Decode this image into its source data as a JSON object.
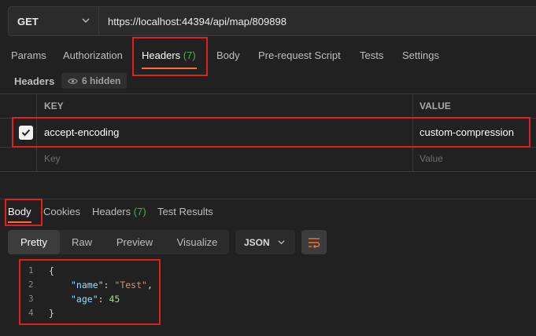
{
  "request": {
    "method": "GET",
    "url": "https://localhost:44394/api/map/809898"
  },
  "request_tabs": [
    {
      "label": "Params"
    },
    {
      "label": "Authorization"
    },
    {
      "label": "Headers",
      "count": "(7)",
      "active": true
    },
    {
      "label": "Body"
    },
    {
      "label": "Pre-request Script"
    },
    {
      "label": "Tests"
    },
    {
      "label": "Settings"
    }
  ],
  "headers_section": {
    "title": "Headers",
    "hidden_label": "6 hidden",
    "columns": {
      "key": "KEY",
      "value": "VALUE"
    },
    "rows": [
      {
        "checked": true,
        "key": "accept-encoding",
        "value": "custom-compression"
      }
    ],
    "placeholder": {
      "key": "Key",
      "value": "Value"
    }
  },
  "response_tabs": [
    {
      "label": "Body",
      "active": true
    },
    {
      "label": "Cookies"
    },
    {
      "label": "Headers",
      "count": "(7)"
    },
    {
      "label": "Test Results"
    }
  ],
  "view_modes": [
    {
      "label": "Pretty",
      "active": true
    },
    {
      "label": "Raw"
    },
    {
      "label": "Preview"
    },
    {
      "label": "Visualize"
    }
  ],
  "format_select": {
    "value": "JSON"
  },
  "response_body": {
    "line_numbers": [
      "1",
      "2",
      "3",
      "4"
    ],
    "open_brace": "{",
    "close_brace": "}",
    "name_key": "\"name\"",
    "name_value": "\"Test\"",
    "age_key": "\"age\"",
    "age_value": "45"
  },
  "colors": {
    "accent": "#ff6c37",
    "count": "#4caf50",
    "highlight": "#e02020",
    "background": "#212121"
  },
  "icons": [
    "chevron-down-icon",
    "eye-icon",
    "checkmark-icon",
    "wrap-lines-icon"
  ]
}
